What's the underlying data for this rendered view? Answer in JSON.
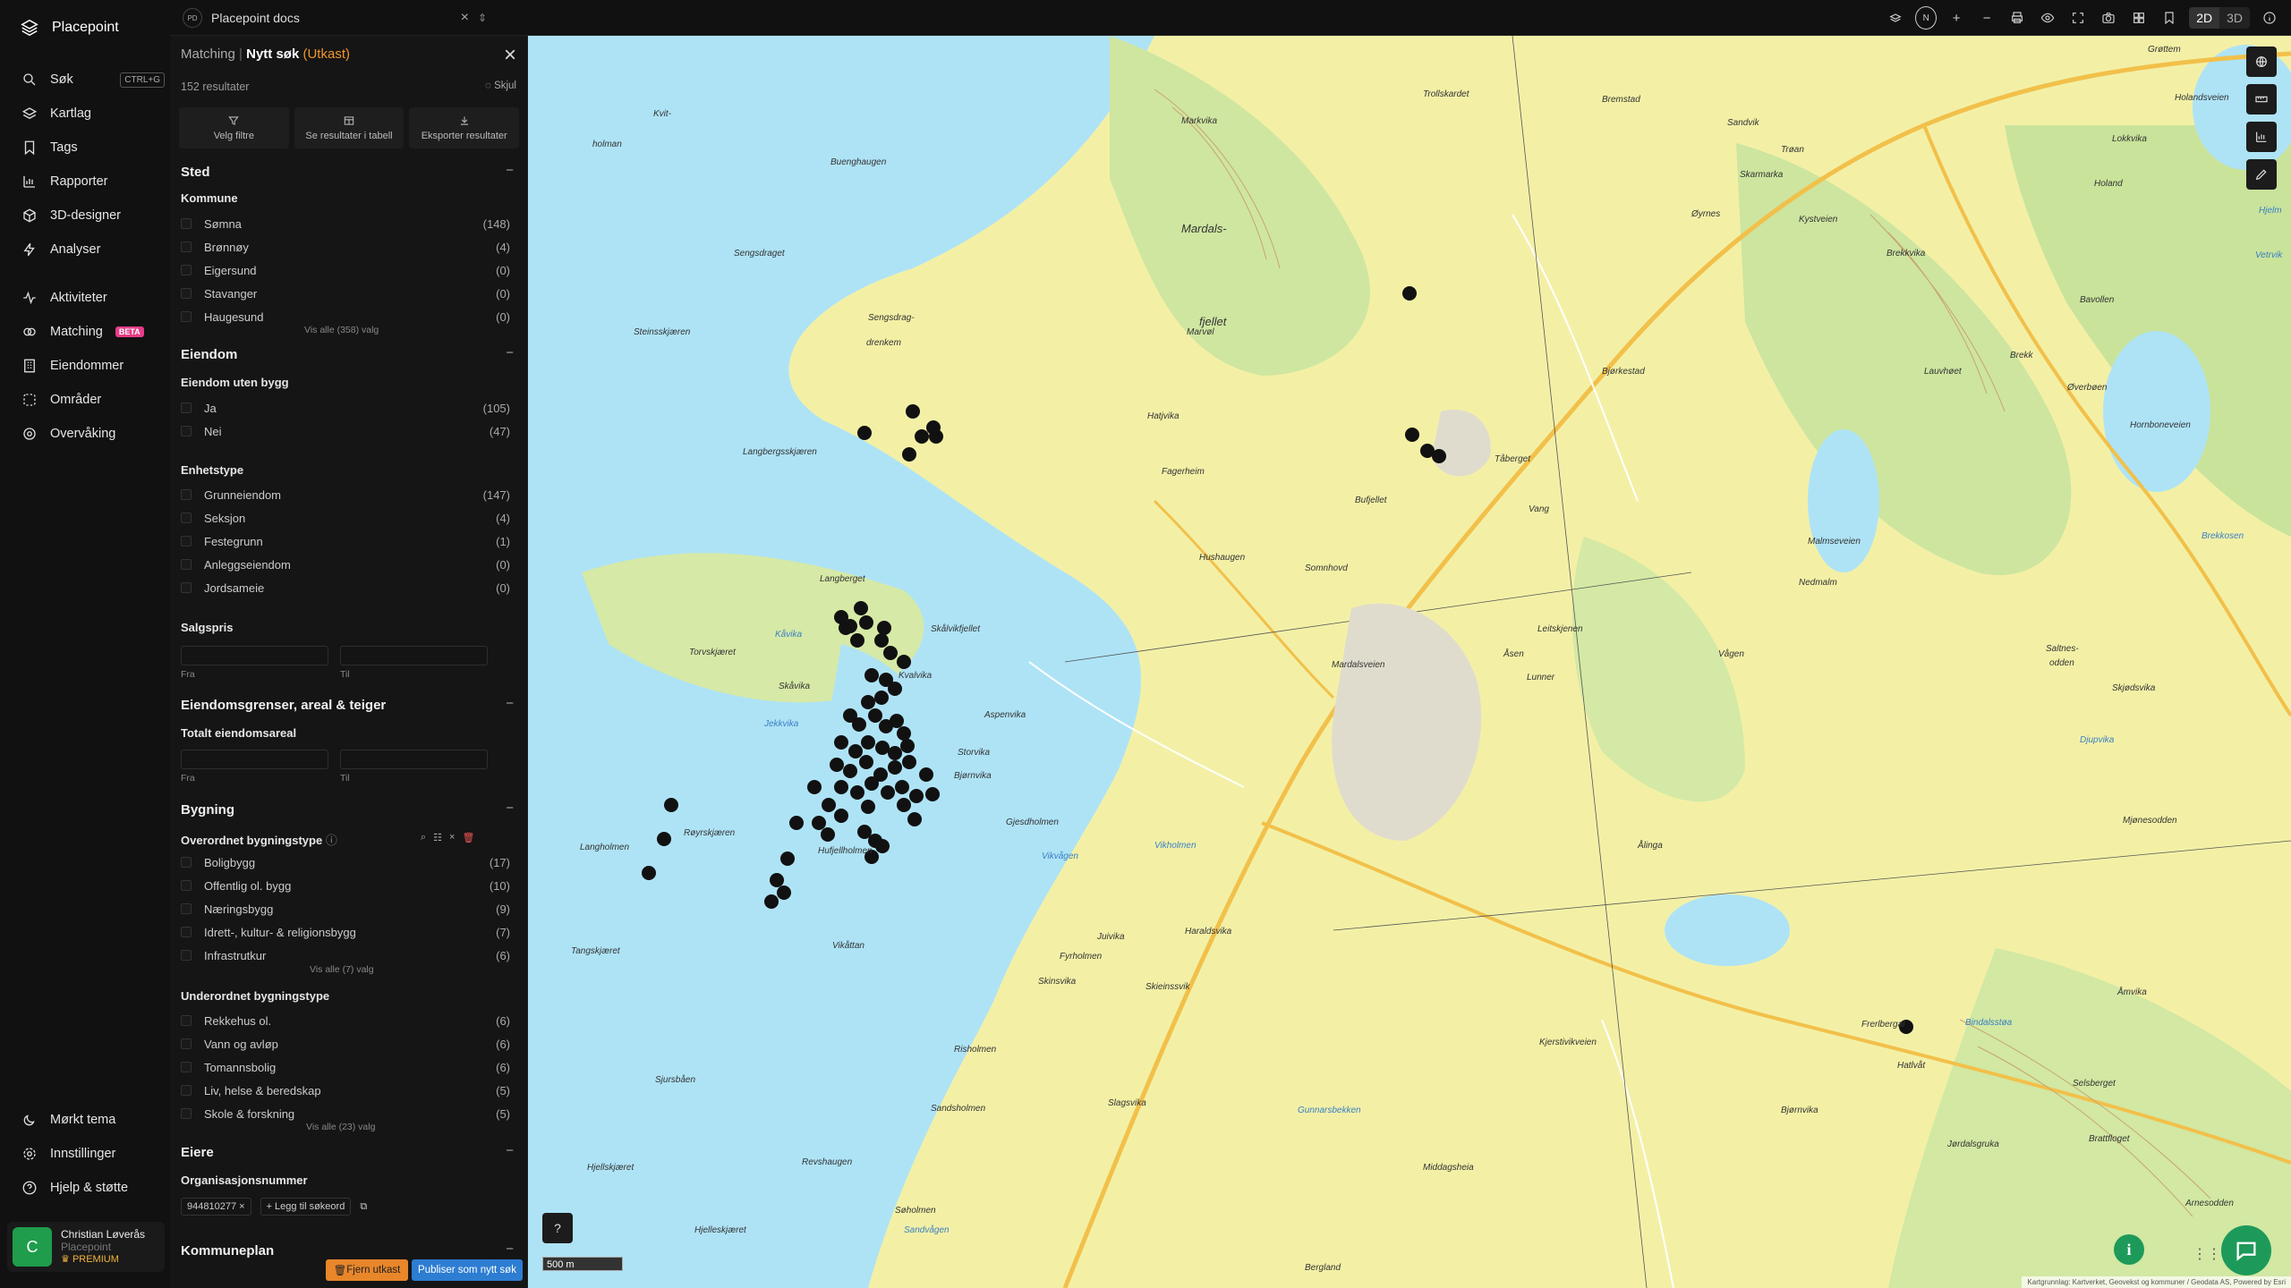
{
  "app": {
    "name": "Placepoint"
  },
  "nav": {
    "search": {
      "label": "Søk",
      "shortcut": "CTRL+G"
    },
    "items": [
      "Kartlag",
      "Tags",
      "Rapporter",
      "3D-designer",
      "Analyser"
    ],
    "items2": [
      "Aktiviteter",
      "Matching",
      "Eiendommer",
      "Områder",
      "Overvåking"
    ],
    "beta": "BETA",
    "bottom": [
      "Mørkt tema",
      "Innstillinger",
      "Hjelp & støtte"
    ],
    "user": {
      "initial": "C",
      "name": "Christian Løverås",
      "org": "Placepoint",
      "plan": "PREMIUM"
    }
  },
  "topbar": {
    "workspace_badge": "PD",
    "workspace": "Placepoint docs",
    "compass": "N",
    "view2d": "2D",
    "view3d": "3D"
  },
  "panel": {
    "crumb": "Matching",
    "title": "Nytt søk",
    "draft": "(Utkast)",
    "count": "152 resultater",
    "hide": "Skjul",
    "actions": [
      "Velg filtre",
      "Se resultater i tabell",
      "Eksporter resultater"
    ],
    "sted": {
      "title": "Sted",
      "sub": "Kommune",
      "rows": [
        [
          "Sømna",
          "(148)"
        ],
        [
          "Brønnøy",
          "(4)"
        ],
        [
          "Eigersund",
          "(0)"
        ],
        [
          "Stavanger",
          "(0)"
        ],
        [
          "Haugesund",
          "(0)"
        ]
      ],
      "showall": "Vis alle (358) valg"
    },
    "eiendom": {
      "title": "Eiendom",
      "sub1": "Eiendom uten bygg",
      "rows1": [
        [
          "Ja",
          "(105)"
        ],
        [
          "Nei",
          "(47)"
        ]
      ],
      "sub2": "Enhetstype",
      "rows2": [
        [
          "Grunneiendom",
          "(147)"
        ],
        [
          "Seksjon",
          "(4)"
        ],
        [
          "Festegrunn",
          "(1)"
        ],
        [
          "Anleggseiendom",
          "(0)"
        ],
        [
          "Jordsameie",
          "(0)"
        ]
      ],
      "sub3": "Salgspris",
      "from": "Fra",
      "to": "Til"
    },
    "grenser": {
      "title": "Eiendomsgrenser, areal & teiger",
      "sub": "Totalt eiendomsareal",
      "from": "Fra",
      "to": "Til"
    },
    "bygning": {
      "title": "Bygning",
      "sub1": "Overordnet bygningstype",
      "rows1": [
        [
          "Boligbygg",
          "(17)"
        ],
        [
          "Offentlig ol. bygg",
          "(10)"
        ],
        [
          "Næringsbygg",
          "(9)"
        ],
        [
          "Idrett-, kultur- & religionsbygg",
          "(7)"
        ],
        [
          "Infrastrutkur",
          "(6)"
        ]
      ],
      "showall1": "Vis alle (7) valg",
      "sub2": "Underordnet bygningstype",
      "rows2": [
        [
          "Rekkehus ol.",
          "(6)"
        ],
        [
          "Vann og avløp",
          "(6)"
        ],
        [
          "Tomannsbolig",
          "(6)"
        ],
        [
          "Liv, helse & beredskap",
          "(5)"
        ],
        [
          "Skole & forskning",
          "(5)"
        ]
      ],
      "showall2": "Vis alle (23) valg"
    },
    "eiere": {
      "title": "Eiere",
      "sub": "Organisasjonsnummer",
      "tag": "944810277",
      "add": "Legg til søkeord"
    },
    "kommuneplan": {
      "title": "Kommuneplan"
    },
    "btn_remove": "Fjern utkast",
    "btn_publish": "Publiser som nytt søk"
  },
  "map": {
    "scale": "500 m",
    "attribution": "Kartgrunnlag: Kartverket, Geovekst og kommuner / Geodata AS, Powered by Esri",
    "labels": [
      "Mardals-",
      "fjellet",
      "Trollskardet",
      "Kvit-",
      "holman",
      "Markvika",
      "Buenghaugen",
      "Sengsdraget",
      "Sengsdrag-",
      "drenkem",
      "Steinsskjæren",
      "Langbergsskjæren",
      "Marvøl",
      "Hatjvika",
      "Fagerheim",
      "Bufjellet",
      "Tåberget",
      "Vang",
      "Somnhovd",
      "Mardalsveien",
      "Hushaugen",
      "Langberget",
      "Kåvika",
      "Skålvikfjellet",
      "Torvskjæret",
      "Skåvika",
      "Kvalvika",
      "Aspenvika",
      "Jekkvika",
      "Storvika",
      "Bjørnvika",
      "Røyrskjæren",
      "Hufjellholmen",
      "Langholmen",
      "Vikvågen",
      "Gjesdholmen",
      "Vikholmen",
      "Haraldsvika",
      "Juivika",
      "Fyrholmen",
      "Vikåttan",
      "Tangskjæret",
      "Skieinssvik",
      "Skinsvika",
      "Risholmen",
      "Slagsvika",
      "Sandsholmen",
      "Sjursbåen",
      "Hjellskjæret",
      "Revshaugen",
      "Søholmen",
      "Hjelleskjæret",
      "Sandvågen",
      "Bergland",
      "Gunnarsbekken",
      "Middagsheia",
      "Kjerstivikveien",
      "Bindalsstøa",
      "Frerlbergal",
      "Skarmarka",
      "Øyrnes",
      "Kystveien",
      "Brekkvika",
      "Bavollen",
      "Brekk",
      "Øverbøen",
      "Hornboneveien",
      "Malmseveien",
      "Brekkosen",
      "Nedmalm",
      "Saltnes-",
      "odden",
      "Skjødsvika",
      "Djupvika",
      "Mjønesodden",
      "Åmvika",
      "Jørdalsgruka",
      "Arnesodden",
      "Brattfloget",
      "Selsberget",
      "Hatlvåt",
      "Grøttem",
      "Holandsveien",
      "Bremstad",
      "Sandvik",
      "Trøan",
      "Holand",
      "Lokkvika",
      "Vetrvik",
      "Hjelm",
      "Lauvhøet",
      "Bjørkestad",
      "Vågen",
      "Leitskjenen",
      "Lunner",
      "Åsen",
      "Ålinga",
      "Bjørnvika",
      "Bergland"
    ],
    "markers": 74
  }
}
